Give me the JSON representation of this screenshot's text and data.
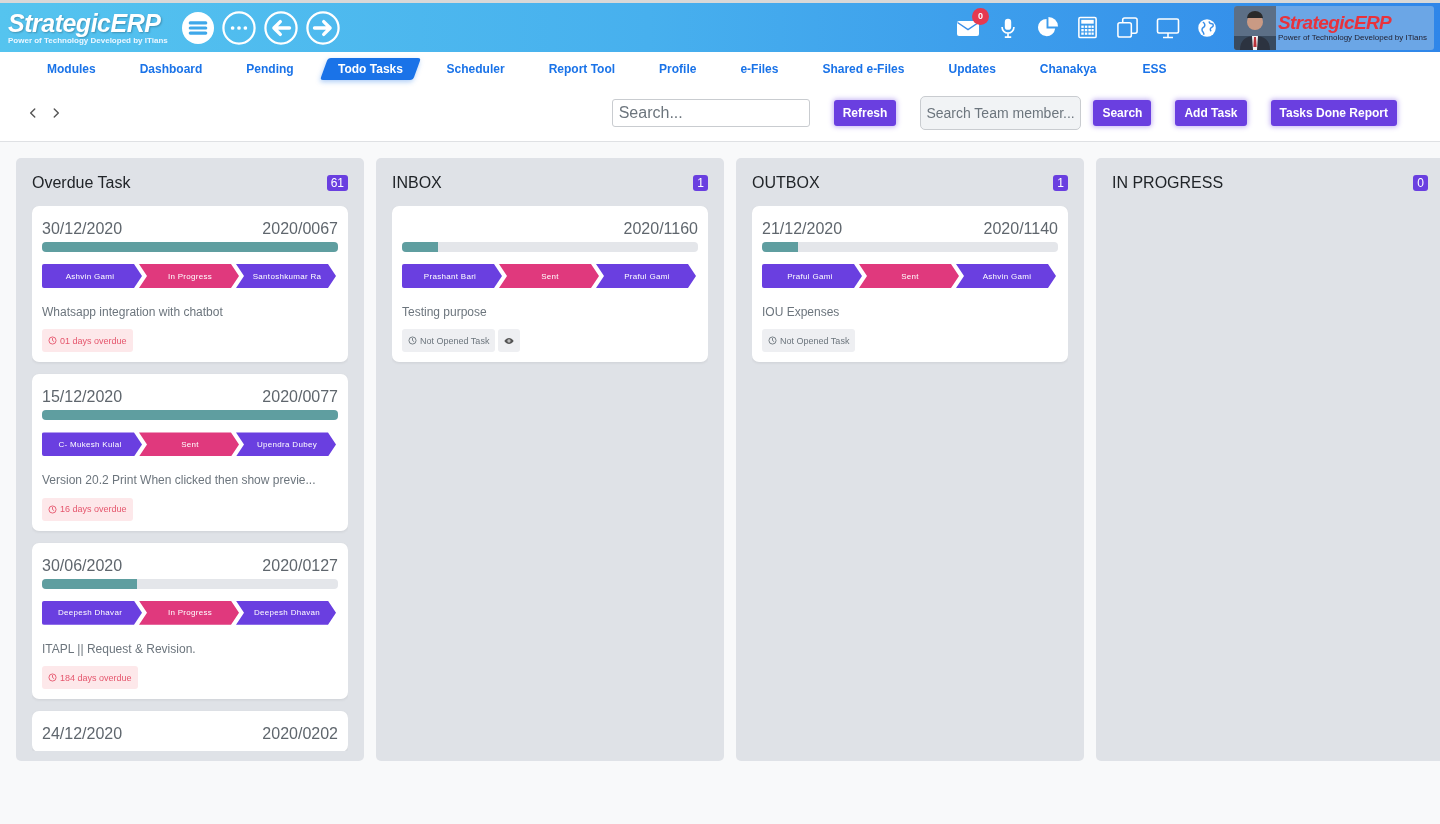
{
  "header": {
    "logo": {
      "name": "StrategicERP",
      "tagline": "Power of Technology Developed by ITians"
    },
    "mail_count": "0",
    "brand": {
      "name": "StrategicERP",
      "tagline": "Power of Technology Developed by ITians"
    }
  },
  "nav": {
    "items": [
      {
        "label": "Modules",
        "selected": false
      },
      {
        "label": "Dashboard",
        "selected": false
      },
      {
        "label": "Pending",
        "selected": false
      },
      {
        "label": "Todo Tasks",
        "selected": true
      },
      {
        "label": "Scheduler",
        "selected": false
      },
      {
        "label": "Report Tool",
        "selected": false
      },
      {
        "label": "Profile",
        "selected": false
      },
      {
        "label": "e-Files",
        "selected": false
      },
      {
        "label": "Shared e-Files",
        "selected": false
      },
      {
        "label": "Updates",
        "selected": false
      },
      {
        "label": "Chanakya",
        "selected": false
      },
      {
        "label": "ESS",
        "selected": false
      }
    ]
  },
  "toolbar": {
    "search": {
      "placeholder": "Search..."
    },
    "refresh": "Refresh",
    "team_search": {
      "placeholder": "Search Team member..."
    },
    "buttons": [
      "Search",
      "Add Task",
      "Tasks Done Report"
    ]
  },
  "columns": [
    {
      "title": "Overdue Task",
      "count": "61",
      "tasks": [
        {
          "date": "30/12/2020",
          "number": "2020/0067",
          "level": 1,
          "steps": [
            {
              "label": "Ashvin Gami",
              "kind": "person"
            },
            {
              "label": "In Progress",
              "kind": "status"
            },
            {
              "label": "Santoshkumar Ra",
              "kind": "person"
            }
          ],
          "description": "Whatsapp integration with chatbot",
          "badges": [
            {
              "kind": "overdue",
              "text": "01 days overdue"
            }
          ]
        },
        {
          "date": "15/12/2020",
          "number": "2020/0077",
          "level": 1,
          "steps": [
            {
              "label": "C- Mukesh Kulal",
              "kind": "person"
            },
            {
              "label": "Sent",
              "kind": "status"
            },
            {
              "label": "Upendra Dubey",
              "kind": "person"
            }
          ],
          "description": "Version 20.2 Print When clicked then show previe...",
          "badges": [
            {
              "kind": "overdue",
              "text": "16 days overdue"
            }
          ]
        },
        {
          "date": "30/06/2020",
          "number": "2020/0127",
          "level": 0.32,
          "steps": [
            {
              "label": "Deepesh Dhavar",
              "kind": "person"
            },
            {
              "label": "In Progress",
              "kind": "status"
            },
            {
              "label": "Deepesh Dhavan",
              "kind": "person"
            }
          ],
          "description": "ITAPL || Request & Revision.",
          "badges": [
            {
              "kind": "overdue",
              "text": "184 days overdue"
            }
          ]
        },
        {
          "date": "24/12/2020",
          "number": "2020/0202"
        }
      ]
    },
    {
      "title": "INBOX",
      "count": "1",
      "tasks": [
        {
          "number": "2020/1160",
          "level": 0.12,
          "steps": [
            {
              "label": "Prashant Bari",
              "kind": "person"
            },
            {
              "label": "Sent",
              "kind": "status"
            },
            {
              "label": "Praful Gami",
              "kind": "person"
            }
          ],
          "description": "Testing purpose",
          "badges": [
            {
              "kind": "not_opened",
              "text": "Not Opened Task"
            },
            {
              "kind": "view"
            }
          ]
        }
      ]
    },
    {
      "title": "OUTBOX",
      "count": "1",
      "tasks": [
        {
          "date": "21/12/2020",
          "number": "2020/1140",
          "level": 0.12,
          "steps": [
            {
              "label": "Praful Gami",
              "kind": "person"
            },
            {
              "label": "Sent",
              "kind": "status"
            },
            {
              "label": "Ashvin Gami",
              "kind": "person"
            }
          ],
          "description": "IOU Expenses",
          "badges": [
            {
              "kind": "not_opened",
              "text": "Not Opened Task"
            }
          ]
        }
      ]
    },
    {
      "title": "IN PROGRESS",
      "count": "0"
    }
  ]
}
